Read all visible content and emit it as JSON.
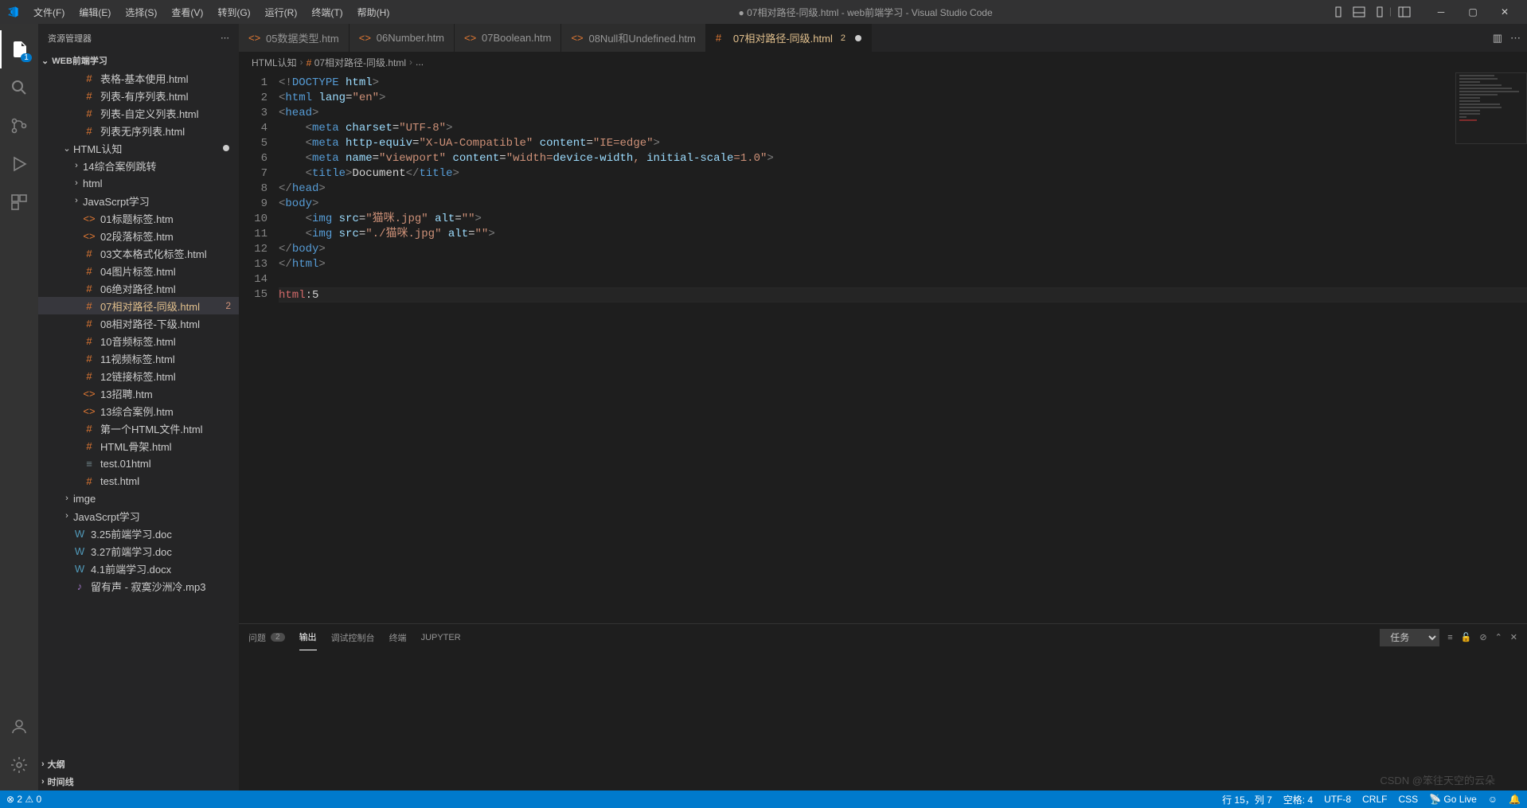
{
  "title": "● 07相对路径-同级.html - web前端学习 - Visual Studio Code",
  "menus": [
    "文件(F)",
    "编辑(E)",
    "选择(S)",
    "查看(V)",
    "转到(G)",
    "运行(R)",
    "终端(T)",
    "帮助(H)"
  ],
  "activitybar": {
    "explorer_badge": "1"
  },
  "sidebar": {
    "title": "资源管理器",
    "project": "WEB前端学习",
    "items": [
      {
        "label": "表格-基本使用.html",
        "icon": "html",
        "indent": 2
      },
      {
        "label": "列表-有序列表.html",
        "icon": "html",
        "indent": 2
      },
      {
        "label": "列表-自定义列表.html",
        "icon": "html",
        "indent": 2
      },
      {
        "label": "列表无序列表.html",
        "icon": "html",
        "indent": 2
      },
      {
        "label": "HTML认知",
        "icon": "folder-open",
        "indent": 1,
        "chev": "v",
        "dot": true
      },
      {
        "label": "14综合案例跳转",
        "icon": "folder",
        "indent": 2,
        "chev": ">"
      },
      {
        "label": "html",
        "icon": "folder",
        "indent": 2,
        "chev": ">"
      },
      {
        "label": "JavaScrpt学习",
        "icon": "folder",
        "indent": 2,
        "chev": ">"
      },
      {
        "label": "01标题标签.htm",
        "icon": "htm",
        "indent": 2
      },
      {
        "label": "02段落标签.htm",
        "icon": "htm",
        "indent": 2
      },
      {
        "label": "03文本格式化标签.html",
        "icon": "html",
        "indent": 2
      },
      {
        "label": "04图片标签.html",
        "icon": "html",
        "indent": 2
      },
      {
        "label": "06绝对路径.html",
        "icon": "html",
        "indent": 2
      },
      {
        "label": "07相对路径-同级.html",
        "icon": "html",
        "indent": 2,
        "active": true,
        "modified": true,
        "badge": "2"
      },
      {
        "label": "08相对路径-下级.html",
        "icon": "html",
        "indent": 2
      },
      {
        "label": "10音频标签.html",
        "icon": "html",
        "indent": 2
      },
      {
        "label": "11视频标签.html",
        "icon": "html",
        "indent": 2
      },
      {
        "label": "12链接标签.html",
        "icon": "html",
        "indent": 2
      },
      {
        "label": "13招聘.htm",
        "icon": "htm",
        "indent": 2
      },
      {
        "label": "13综合案例.htm",
        "icon": "htm",
        "indent": 2
      },
      {
        "label": "第一个HTML文件.html",
        "icon": "html",
        "indent": 2
      },
      {
        "label": "HTML骨架.html",
        "icon": "html",
        "indent": 2
      },
      {
        "label": "test.01html",
        "icon": "text",
        "indent": 2
      },
      {
        "label": "test.html",
        "icon": "html",
        "indent": 2
      },
      {
        "label": "imge",
        "icon": "folder",
        "indent": 1,
        "chev": ">"
      },
      {
        "label": "JavaScrpt学习",
        "icon": "folder",
        "indent": 1,
        "chev": ">"
      },
      {
        "label": "3.25前端学习.doc",
        "icon": "doc",
        "indent": 1
      },
      {
        "label": "3.27前端学习.doc",
        "icon": "doc",
        "indent": 1
      },
      {
        "label": "4.1前端学习.docx",
        "icon": "doc",
        "indent": 1
      },
      {
        "label": "留有声 - 寂寞沙洲冷.mp3",
        "icon": "audio",
        "indent": 1
      }
    ],
    "outline": "大纲",
    "timeline": "时间线"
  },
  "tabs": [
    {
      "label": "05数据类型.htm",
      "icon": "htm"
    },
    {
      "label": "06Number.htm",
      "icon": "htm"
    },
    {
      "label": "07Boolean.htm",
      "icon": "htm"
    },
    {
      "label": "08Null和Undefined.htm",
      "icon": "htm"
    },
    {
      "label": "07相对路径-同级.html",
      "icon": "html",
      "active": true,
      "modified": true,
      "badge": "2",
      "dot": true
    }
  ],
  "breadcrumbs": [
    "HTML认知",
    "07相对路径-同级.html",
    "..."
  ],
  "code": {
    "lines": [
      {
        "n": "1",
        "html": "<span class='c-punc'>&lt;!</span><span class='c-tag'>DOCTYPE</span> <span class='c-attr'>html</span><span class='c-punc'>&gt;</span>"
      },
      {
        "n": "2",
        "html": "<span class='c-punc'>&lt;</span><span class='c-tag'>html</span> <span class='c-attr'>lang</span>=<span class='c-str'>\"en\"</span><span class='c-punc'>&gt;</span>"
      },
      {
        "n": "3",
        "html": "<span class='c-punc'>&lt;</span><span class='c-tag'>head</span><span class='c-punc'>&gt;</span>"
      },
      {
        "n": "4",
        "html": "    <span class='c-punc'>&lt;</span><span class='c-tag'>meta</span> <span class='c-attr'>charset</span>=<span class='c-str'>\"UTF-8\"</span><span class='c-punc'>&gt;</span>"
      },
      {
        "n": "5",
        "html": "    <span class='c-punc'>&lt;</span><span class='c-tag'>meta</span> <span class='c-attr'>http-equiv</span>=<span class='c-str'>\"X-UA-Compatible\"</span> <span class='c-attr'>content</span>=<span class='c-str'>\"IE=edge\"</span><span class='c-punc'>&gt;</span>"
      },
      {
        "n": "6",
        "html": "    <span class='c-punc'>&lt;</span><span class='c-tag'>meta</span> <span class='c-attr'>name</span>=<span class='c-str'>\"viewport\"</span> <span class='c-attr'>content</span>=<span class='c-str'>\"width=</span><span class='c-attr'>device-width</span><span class='c-str'>, </span><span class='c-attr'>initial-scale</span><span class='c-str'>=1.0\"</span><span class='c-punc'>&gt;</span>"
      },
      {
        "n": "7",
        "html": "    <span class='c-punc'>&lt;</span><span class='c-tag'>title</span><span class='c-punc'>&gt;</span>Document<span class='c-punc'>&lt;/</span><span class='c-tag'>title</span><span class='c-punc'>&gt;</span>"
      },
      {
        "n": "8",
        "html": "<span class='c-punc'>&lt;/</span><span class='c-tag'>head</span><span class='c-punc'>&gt;</span>"
      },
      {
        "n": "9",
        "html": "<span class='c-punc'>&lt;</span><span class='c-tag'>body</span><span class='c-punc'>&gt;</span>"
      },
      {
        "n": "10",
        "html": "    <span class='c-punc'>&lt;</span><span class='c-tag'>img</span> <span class='c-attr'>src</span>=<span class='c-str'>\"猫咪.jpg\"</span> <span class='c-attr'>alt</span>=<span class='c-str'>\"\"</span><span class='c-punc'>&gt;</span>"
      },
      {
        "n": "11",
        "html": "    <span class='c-punc'>&lt;</span><span class='c-tag'>img</span> <span class='c-attr'>src</span>=<span class='c-str'>\"./猫咪.jpg\"</span> <span class='c-attr'>alt</span>=<span class='c-str'>\"\"</span><span class='c-punc'>&gt;</span>"
      },
      {
        "n": "12",
        "html": "<span class='c-punc'>&lt;/</span><span class='c-tag'>body</span><span class='c-punc'>&gt;</span>"
      },
      {
        "n": "13",
        "html": "<span class='c-punc'>&lt;/</span><span class='c-tag'>html</span><span class='c-punc'>&gt;</span>"
      },
      {
        "n": "14",
        "html": ""
      },
      {
        "n": "15",
        "html": "<span class='c-emmet'>html</span>:5",
        "current": true
      }
    ]
  },
  "panel": {
    "tabs": [
      {
        "label": "问题",
        "badge": "2"
      },
      {
        "label": "输出",
        "active": true
      },
      {
        "label": "调试控制台"
      },
      {
        "label": "终端"
      },
      {
        "label": "JUPYTER"
      }
    ],
    "dropdown": "任务"
  },
  "statusbar": {
    "errors": "2",
    "warnings": "0",
    "line_col": "行 15，列 7",
    "spaces": "空格: 4",
    "encoding": "UTF-8",
    "eol": "CRLF",
    "lang": "CSS",
    "golive": "Go Live"
  },
  "watermark": "CSDN @笨往天空的云朵"
}
